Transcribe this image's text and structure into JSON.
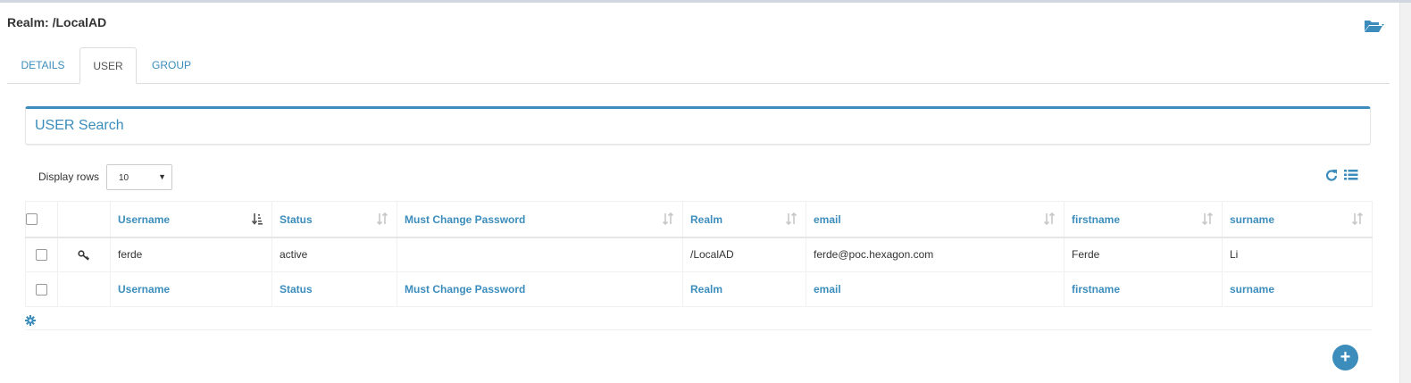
{
  "header": {
    "realm_title": "Realm: /LocalAD"
  },
  "tabs": [
    {
      "label": "DETAILS",
      "active": false
    },
    {
      "label": "USER",
      "active": true
    },
    {
      "label": "GROUP",
      "active": false
    }
  ],
  "panel": {
    "title": "USER Search"
  },
  "controls": {
    "display_rows_label": "Display rows",
    "display_rows_value": "10"
  },
  "table": {
    "columns": [
      "Username",
      "Status",
      "Must Change Password",
      "Realm",
      "email",
      "firstname",
      "surname"
    ],
    "rows": [
      {
        "username": "ferde",
        "status": "active",
        "must_change_password": "",
        "realm": "/LocalAD",
        "email": "ferde@poc.hexagon.com",
        "firstname": "Ferde",
        "surname": "Li"
      }
    ]
  },
  "icons": {
    "folder": "folder-open-icon",
    "refresh": "refresh-icon",
    "list": "list-icon",
    "key": "key-icon",
    "settings": "gear-icon",
    "add": "plus-icon"
  },
  "colors": {
    "accent": "#3c8dbc",
    "border": "#dddddd"
  }
}
